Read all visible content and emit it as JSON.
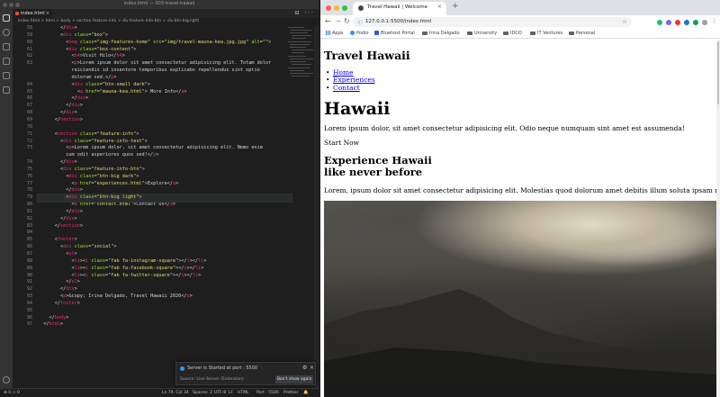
{
  "vscode": {
    "window_title": "index.html — 003-travel-hawaii",
    "tab_label": "index.html",
    "breadcrumb": "index.html > html > body > section.feature-info > div.feature-info-btn > div.btn-big.light",
    "line_numbers": [
      "58",
      "59",
      "60",
      "61",
      "62",
      "63",
      "",
      "",
      "64",
      "65",
      "66",
      "67",
      "68",
      "69",
      "70",
      "71",
      "72",
      "73",
      "",
      "74",
      "75",
      "76",
      "77",
      "78",
      "79",
      "80",
      "81",
      "82",
      "83",
      "84",
      "85",
      "86",
      "87",
      "88",
      "89",
      "90",
      "91",
      "92",
      "93",
      "94",
      "95",
      "96",
      "97"
    ],
    "code_lines": [
      "        </div>",
      "        <div class=\"box\">",
      "          <img class=\"img-features-home\" src=\"img/travel-mauna-kea.jpg.jpg\" alt=\"\">",
      "          <div class=\"box-content\">",
      "            <h4>Visit Hilo</h4>",
      "            <p>Lorem ipsum dolor sit amet consectetur adipisicing elit. Totam dolor",
      "            reiciendis id inventore temporibus explicabo repellendus sint optio",
      "            dolorum sed.</p>",
      "            <div class=\"btn-small dark\">",
      "              <a href=\"mauna-kea.html\"> More Info</a>",
      "            </div>",
      "          </div>",
      "        </div>",
      "      </section>",
      "",
      "      <section class=\"feature-info\">",
      "        <div class=\"feature-info-text\">",
      "          <p>Lorem ipsum dolor, sit amet consectetur adipisicing elit. Nemo enim",
      "          cum odit asperiores quos sed!</p>",
      "        </div>",
      "        <div class=\"feature-info-btn\">",
      "          <div class=\"btn-big dark\">",
      "            <a href=\"experiences.html\">Explore</a>",
      "          </div>",
      "          <div class=\"btn-big light\">",
      "            <a href=\"contact.html\">Contact Us</a>",
      "          </div>",
      "        </div>",
      "      </section>",
      "",
      "      <footer>",
      "        <div class=\"social\">",
      "          <ul>",
      "            <li><i class=\"fab fa-instagram-square\"></i></li>",
      "            <li><i class=\"fab fa-facebook-square\"></i></li>",
      "            <li><i class=\"fab fa-twitter-square\"></i></li>",
      "          </ul>",
      "        </div>",
      "        <p>&copy; Irina Delgado, Travel Hawaii 2020</p>",
      "      </footer>",
      "",
      "    </body>",
      "  </html>"
    ],
    "current_line_index": 24,
    "status": {
      "errors": "0",
      "warnings": "0",
      "position": "Ln 79, Col 34",
      "indent": "Spaces: 2",
      "encoding": "UTF-8",
      "eol": "LF",
      "language": "HTML",
      "port": "Port : 5500",
      "formatter": "Prettier"
    },
    "toast": {
      "message": "Server is Started at port : 5500",
      "source": "Source: Live Server (Extension)",
      "button": "Don't show again"
    }
  },
  "browser": {
    "tab_title": "Travel Hawaii | Welcome",
    "url": "127.0.0.1:5500/index.html",
    "bookmarks": [
      "Apps",
      "Podio",
      "Bluehost Portal",
      "Irina Delgado",
      "University",
      "IDCO",
      "IT Ventures",
      "Personal"
    ],
    "page": {
      "site_title": "Travel Hawaii",
      "nav": [
        "Home",
        "Experiences",
        "Contact"
      ],
      "hero_title": "Hawaii",
      "hero_text": "Lorem ipsum dolor, sit amet consectetur adipisicing elit. Odio neque numquam sint amet est assumenda!",
      "start_now": "Start Now",
      "exp_title_1": "Experience Hawaii",
      "exp_title_2": "like never before",
      "exp_text": "Lorem, ipsum dolor sit amet consectetur adipisicing elit. Molestias quod dolorum amet debitis illum soluta ipsam nihil accusantium, dolore et."
    }
  }
}
